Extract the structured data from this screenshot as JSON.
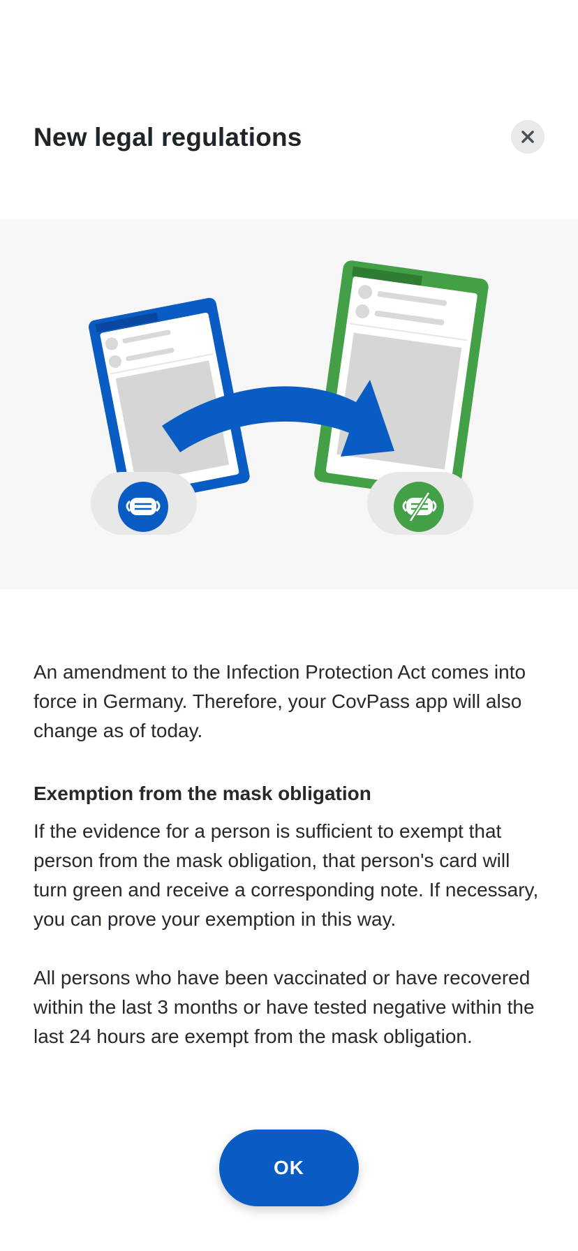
{
  "header": {
    "title": "New legal regulations",
    "close_icon": "close-icon"
  },
  "illustration": {
    "left_phone_color": "#0a5cc5",
    "right_phone_color": "#43a047",
    "arrow_color": "#0a5cc5",
    "left_badge_icon": "mask-icon",
    "right_badge_icon": "mask-crossed-icon"
  },
  "content": {
    "intro": "An amendment to the Infection Protection Act comes into force in Germany. Therefore, your CovPass app will also change as of today.",
    "subheading": "Exemption from the mask obligation",
    "paragraph1": "If the evidence for a person is sufficient to exempt that person from the mask obligation, that person's card will turn green and receive a corresponding note. If necessary, you can prove your exemption in this way.",
    "paragraph2": "All persons who have been vaccinated or have recovered within the last 3 months or have tested negative within the last 24 hours are exempt from the mask obligation."
  },
  "actions": {
    "ok_label": "OK"
  },
  "colors": {
    "primary": "#0a5cc5",
    "success": "#43a047",
    "text": "#25292e",
    "illustration_bg": "#f7f7f7"
  }
}
